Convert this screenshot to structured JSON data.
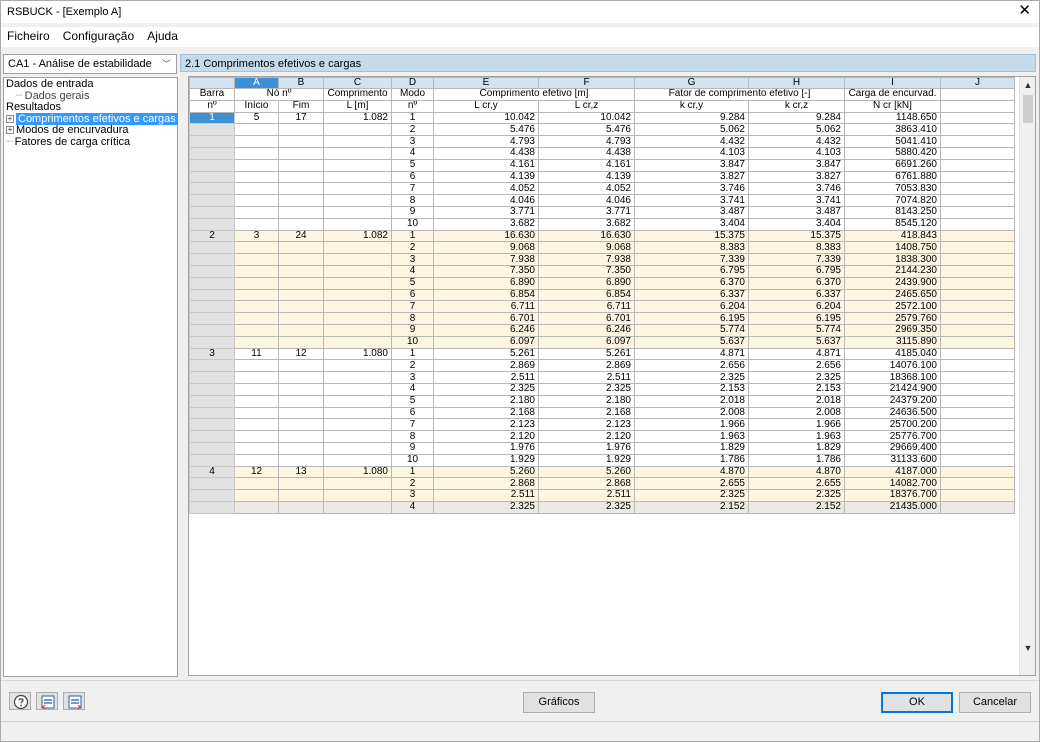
{
  "window": {
    "title": "RSBUCK - [Exemplo A]"
  },
  "menu": [
    "Ficheiro",
    "Configuração",
    "Ajuda"
  ],
  "case_select": {
    "value": "CA1 - Análise de estabilidade"
  },
  "tree": {
    "input_label": "Dados de entrada",
    "input_general": "Dados gerais",
    "results_label": "Resultados",
    "results_items": [
      "Comprimentos efetivos e cargas",
      "Modos de encurvadura",
      "Fatores de carga crítica"
    ]
  },
  "section_title": "2.1 Comprimentos efetivos e cargas",
  "table": {
    "col_letters": [
      "A",
      "B",
      "C",
      "D",
      "E",
      "F",
      "G",
      "H",
      "I",
      "J"
    ],
    "hdr": {
      "barra": "Barra",
      "barra_n": "nº",
      "no_n": "Nó nº",
      "inicio": "Início",
      "fim": "Fim",
      "comprimento": "Comprimento",
      "l_m": "L [m]",
      "modo": "Modo",
      "modo_n": "nº",
      "comp_efetivo": "Comprimento efetivo [m]",
      "lcr_y": "L cr,y",
      "lcr_z": "L cr,z",
      "fator": "Fator de comprimento efetivo [-]",
      "kcr_y": "k cr,y",
      "kcr_z": "k cr,z",
      "carga": "Carga de encurvad.",
      "ncr": "N cr [kN]"
    },
    "members": [
      {
        "barra": "1",
        "inicio": "5",
        "fim": "17",
        "L": "1.082",
        "modes": [
          [
            "1",
            "10.042",
            "10.042",
            "9.284",
            "9.284",
            "1148.650"
          ],
          [
            "2",
            "5.476",
            "5.476",
            "5.062",
            "5.062",
            "3863.410"
          ],
          [
            "3",
            "4.793",
            "4.793",
            "4.432",
            "4.432",
            "5041.410"
          ],
          [
            "4",
            "4.438",
            "4.438",
            "4.103",
            "4.103",
            "5880.420"
          ],
          [
            "5",
            "4.161",
            "4.161",
            "3.847",
            "3.847",
            "6691.260"
          ],
          [
            "6",
            "4.139",
            "4.139",
            "3.827",
            "3.827",
            "6761.880"
          ],
          [
            "7",
            "4.052",
            "4.052",
            "3.746",
            "3.746",
            "7053.830"
          ],
          [
            "8",
            "4.046",
            "4.046",
            "3.741",
            "3.741",
            "7074.820"
          ],
          [
            "9",
            "3.771",
            "3.771",
            "3.487",
            "3.487",
            "8143.250"
          ],
          [
            "10",
            "3.682",
            "3.682",
            "3.404",
            "3.404",
            "8545.120"
          ]
        ]
      },
      {
        "barra": "2",
        "inicio": "3",
        "fim": "24",
        "L": "1.082",
        "modes": [
          [
            "1",
            "16.630",
            "16.630",
            "15.375",
            "15.375",
            "418.843"
          ],
          [
            "2",
            "9.068",
            "9.068",
            "8.383",
            "8.383",
            "1408.750"
          ],
          [
            "3",
            "7.938",
            "7.938",
            "7.339",
            "7.339",
            "1838.300"
          ],
          [
            "4",
            "7.350",
            "7.350",
            "6.795",
            "6.795",
            "2144.230"
          ],
          [
            "5",
            "6.890",
            "6.890",
            "6.370",
            "6.370",
            "2439.900"
          ],
          [
            "6",
            "6.854",
            "6.854",
            "6.337",
            "6.337",
            "2465.650"
          ],
          [
            "7",
            "6.711",
            "6.711",
            "6.204",
            "6.204",
            "2572.100"
          ],
          [
            "8",
            "6.701",
            "6.701",
            "6.195",
            "6.195",
            "2579.760"
          ],
          [
            "9",
            "6.246",
            "6.246",
            "5.774",
            "5.774",
            "2969.350"
          ],
          [
            "10",
            "6.097",
            "6.097",
            "5.637",
            "5.637",
            "3115.890"
          ]
        ]
      },
      {
        "barra": "3",
        "inicio": "11",
        "fim": "12",
        "L": "1.080",
        "modes": [
          [
            "1",
            "5.261",
            "5.261",
            "4.871",
            "4.871",
            "4185.040"
          ],
          [
            "2",
            "2.869",
            "2.869",
            "2.656",
            "2.656",
            "14076.100"
          ],
          [
            "3",
            "2.511",
            "2.511",
            "2.325",
            "2.325",
            "18368.100"
          ],
          [
            "4",
            "2.325",
            "2.325",
            "2.153",
            "2.153",
            "21424.900"
          ],
          [
            "5",
            "2.180",
            "2.180",
            "2.018",
            "2.018",
            "24379.200"
          ],
          [
            "6",
            "2.168",
            "2.168",
            "2.008",
            "2.008",
            "24636.500"
          ],
          [
            "7",
            "2.123",
            "2.123",
            "1.966",
            "1.966",
            "25700.200"
          ],
          [
            "8",
            "2.120",
            "2.120",
            "1.963",
            "1.963",
            "25776.700"
          ],
          [
            "9",
            "1.976",
            "1.976",
            "1.829",
            "1.829",
            "29669.400"
          ],
          [
            "10",
            "1.929",
            "1.929",
            "1.786",
            "1.786",
            "31133.600"
          ]
        ]
      },
      {
        "barra": "4",
        "inicio": "12",
        "fim": "13",
        "L": "1.080",
        "modes": [
          [
            "1",
            "5.260",
            "5.260",
            "4.870",
            "4.870",
            "4187.000"
          ],
          [
            "2",
            "2.868",
            "2.868",
            "2.655",
            "2.655",
            "14082.700"
          ],
          [
            "3",
            "2.511",
            "2.511",
            "2.325",
            "2.325",
            "18376.700"
          ],
          [
            "4",
            "2.325",
            "2.325",
            "2.152",
            "2.152",
            "21435.000"
          ]
        ]
      }
    ]
  },
  "buttons": {
    "graficos": "Gráficos",
    "ok": "OK",
    "cancelar": "Cancelar"
  },
  "icons": [
    "help-icon",
    "import-icon",
    "export-icon"
  ],
  "colors": {
    "selection": "#3399ff",
    "section_header": "#c5dbea",
    "alt_rows": "#fdf5e0",
    "active_col": "#3d8fd6"
  }
}
